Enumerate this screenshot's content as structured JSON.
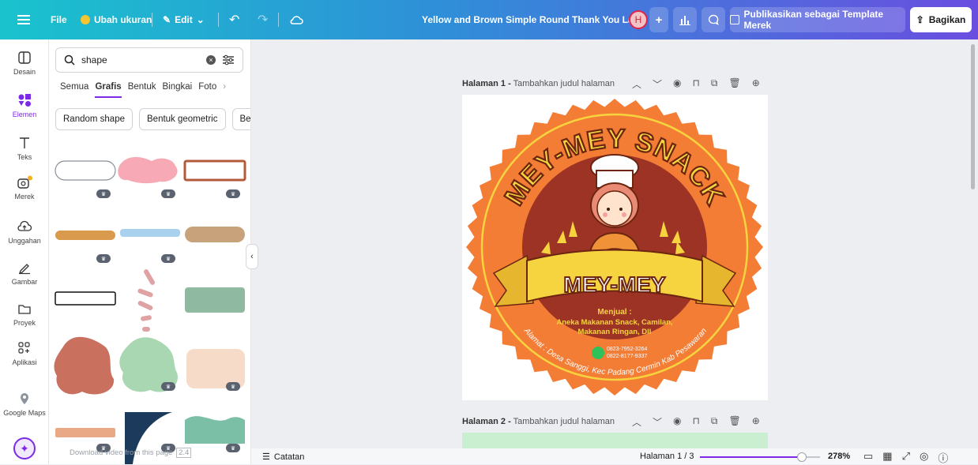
{
  "topbar": {
    "file": "File",
    "resize": "Ubah ukuran",
    "edit": "Edit",
    "doc_title": "Yellow and Brown Simple Round Thank You Label",
    "avatar_initial": "H",
    "add_label": "+",
    "publish": "Publikasikan sebagai Template Merek",
    "share": "Bagikan"
  },
  "rail": {
    "items": [
      {
        "label": "Desain",
        "icon": "layout-icon"
      },
      {
        "label": "Elemen",
        "icon": "elements-icon"
      },
      {
        "label": "Teks",
        "icon": "text-icon"
      },
      {
        "label": "Merek",
        "icon": "brand-icon"
      },
      {
        "label": "Unggahan",
        "icon": "upload-icon"
      },
      {
        "label": "Gambar",
        "icon": "draw-icon"
      },
      {
        "label": "Proyek",
        "icon": "folder-icon"
      },
      {
        "label": "Aplikasi",
        "icon": "apps-icon"
      },
      {
        "label": "Google Maps",
        "icon": "map-pin-icon"
      }
    ]
  },
  "panel": {
    "search_value": "shape",
    "tabs": [
      "Semua",
      "Grafis",
      "Bentuk",
      "Bingkai",
      "Foto"
    ],
    "active_tab": "Grafis",
    "chips": [
      "Random shape",
      "Bentuk geometric",
      "Ber"
    ],
    "video_hint": "Download video from this page",
    "video_hint_suffix": "2.4"
  },
  "pages": {
    "page1_label": "Halaman 1 -",
    "page1_title_placeholder": "Tambahkan judul halaman",
    "page2_label": "Halaman 2 -",
    "page2_title_placeholder": "Tambahkan judul halaman"
  },
  "design": {
    "arc_text": "MEY-MEY SNACK",
    "banner": "MEY-MEY",
    "sell_title": "Menjual :",
    "sell_line1": "Aneka Makanan Snack, Camilan,",
    "sell_line2": "Makanan Ringan, Dll",
    "phone1": "0823-7952-3264",
    "phone2": "0822-8177-9337",
    "address": "Alamat : Desa Sanggi, Kec Padang Cermin Kab Pesawaran"
  },
  "bottom": {
    "notes": "Catatan",
    "page_indicator": "Halaman 1 / 3",
    "zoom": "278%",
    "zoom_level": 0.85
  },
  "colors": {
    "accent": "#7d2ae8",
    "label_orange": "#f47d35",
    "label_dark": "#9c3324",
    "ribbon_yellow": "#f6d43f"
  }
}
